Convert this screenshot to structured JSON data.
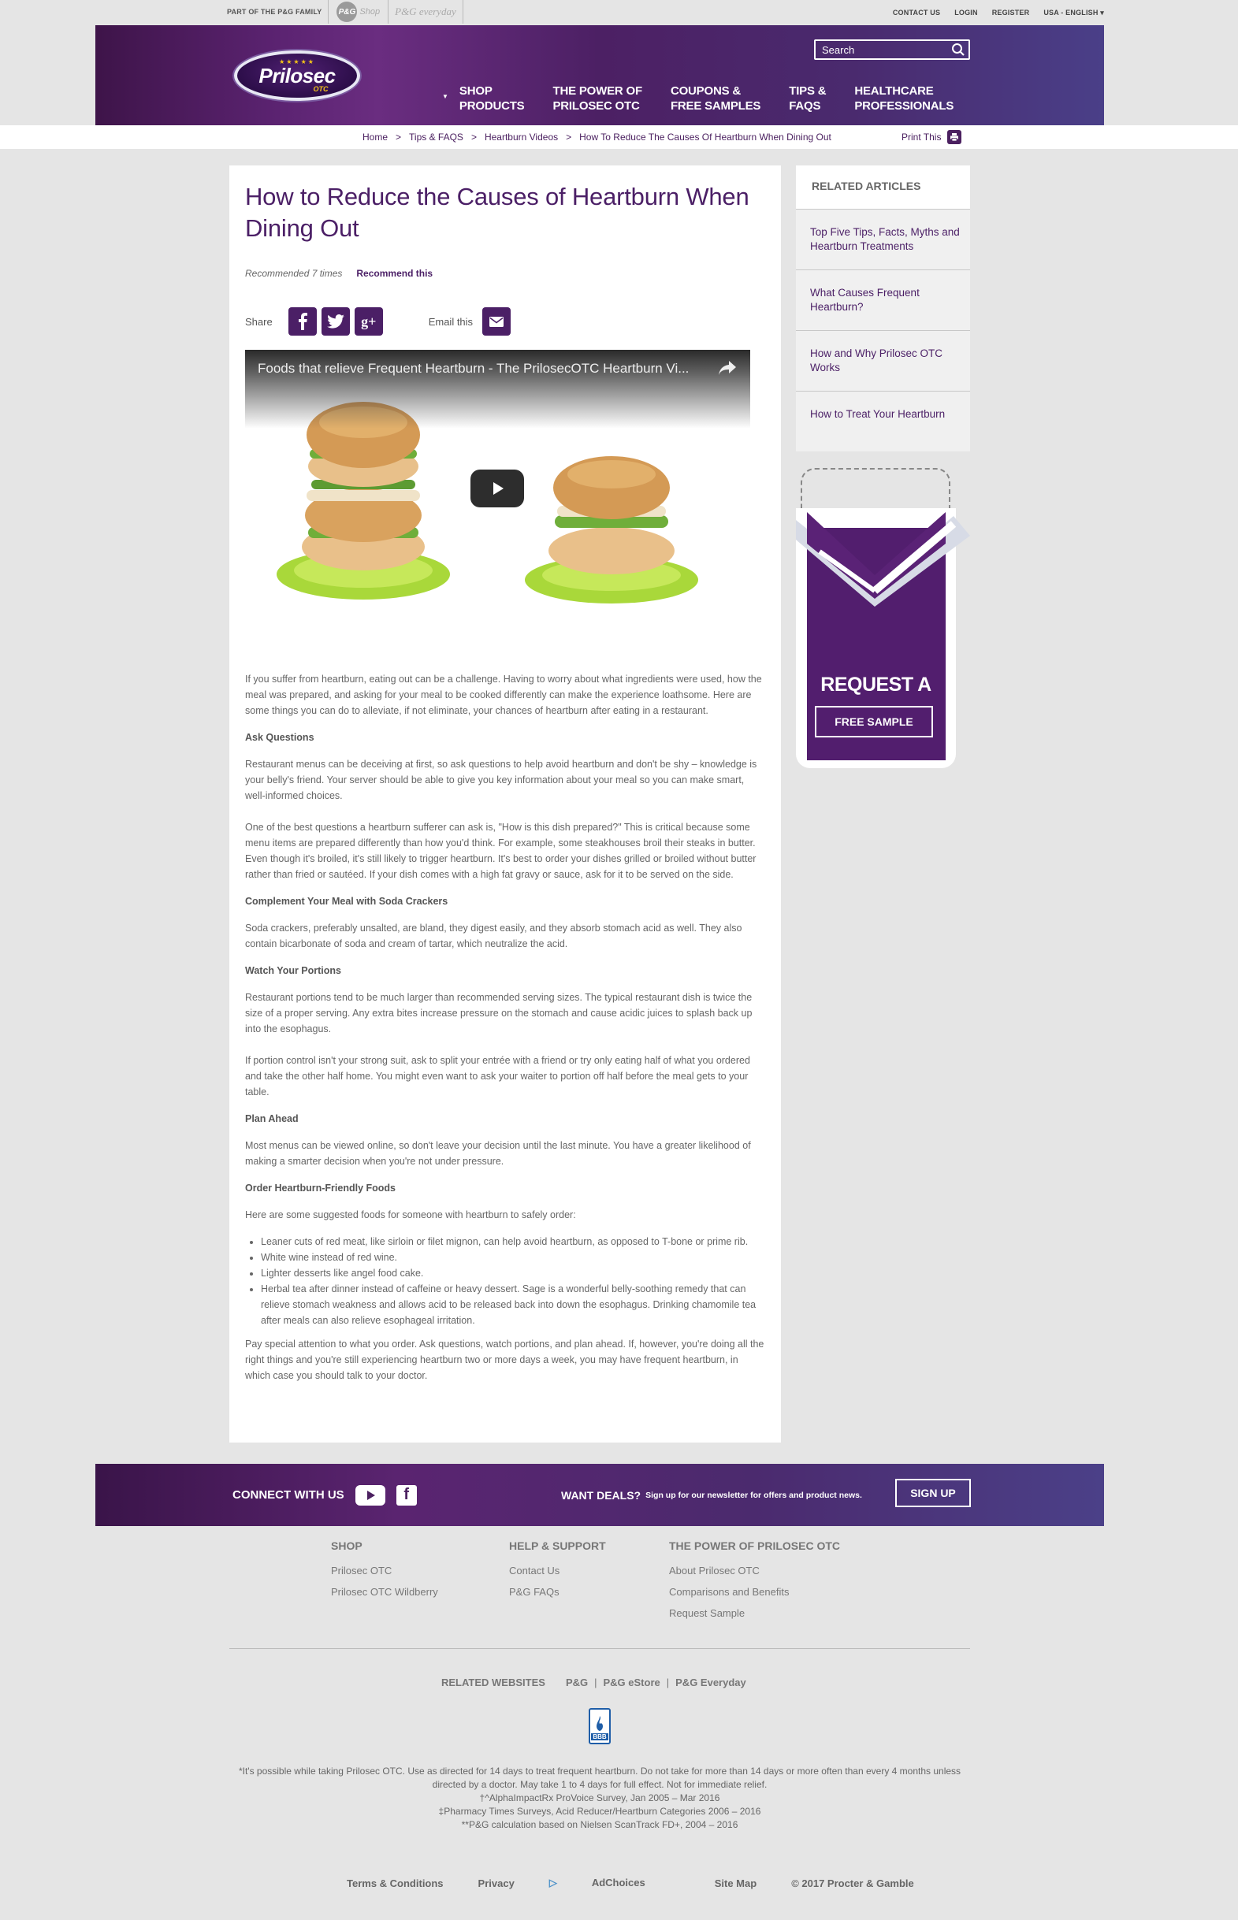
{
  "utility": {
    "pg_family": "PART OF THE P&G FAMILY",
    "pg_logo": "P&G",
    "pg_shop": "Shop",
    "pg_everyday": "P&G everyday",
    "links": [
      "CONTACT US",
      "LOGIN",
      "REGISTER",
      "USA - ENGLISH ▾"
    ]
  },
  "header": {
    "logo_name": "Prilosec",
    "logo_sub": "OTC",
    "logo_stars": "★★★★★",
    "search_placeholder": "Search",
    "nav": [
      "SHOP\nPRODUCTS",
      "THE POWER OF\nPRILOSEC OTC",
      "COUPONS &\nFREE SAMPLES",
      "TIPS &\nFAQS",
      "HEALTHCARE\nPROFESSIONALS"
    ],
    "brand_color": "#4b1f66"
  },
  "breadcrumb": {
    "items": [
      "Home",
      "Tips & FAQS",
      "Heartburn Videos",
      "How To Reduce The Causes Of Heartburn When Dining Out"
    ],
    "print_label": "Print This"
  },
  "article": {
    "title": "How to Reduce the Causes of Heartburn When Dining Out",
    "recommended": "Recommended 7 times",
    "recommend_link": "Recommend this",
    "share_label": "Share",
    "email_label": "Email this",
    "video_title": "Foods that relieve Frequent Heartburn - The PrilosecOTC Heartburn Vi...",
    "intro": "If you suffer from heartburn, eating out can be a challenge. Having to worry about what ingredients were used, how the meal was prepared, and asking for your meal to be cooked differently can make the experience loathsome. Here are some things you can do to alleviate, if not eliminate, your chances of heartburn after eating in a restaurant.",
    "h_ask": "Ask Questions",
    "p_ask1": "Restaurant menus can be deceiving at first, so ask questions to help avoid heartburn and don't be shy – knowledge is your belly's friend. Your server should be able to give you key information about your meal so you can make smart, well-informed choices.",
    "p_ask2": "One of the best questions a heartburn sufferer can ask is, \"How is this dish prepared?\" This is critical because some menu items are prepared differently than how you'd think. For example, some steakhouses broil their steaks in butter. Even though it's broiled, it's still likely to trigger heartburn. It's best to order your dishes grilled or broiled without butter rather than fried or sautéed. If your dish comes with a high fat gravy or sauce, ask for it to be served on the side.",
    "h_soda": "Complement Your Meal with Soda Crackers",
    "p_soda": "Soda crackers, preferably unsalted, are bland, they digest easily, and they absorb stomach acid as well. They also contain bicarbonate of soda and cream of tartar, which neutralize the acid.",
    "h_portions": "Watch Your Portions",
    "p_portions1": "Restaurant portions tend to be much larger than recommended serving sizes. The typical restaurant dish is twice the size of a proper serving. Any extra bites increase pressure on the stomach and cause acidic juices to splash back up into the esophagus.",
    "p_portions2": "If portion control isn't your strong suit, ask to split your entrée with a friend or try only eating half of what you ordered and take the other half home. You might even want to ask your waiter to portion off half before the meal gets to your table.",
    "h_plan": "Plan Ahead",
    "p_plan": "Most menus can be viewed online, so don't leave your decision until the last minute. You have a greater likelihood of making a smarter decision when you're not under pressure.",
    "h_order": "Order Heartburn-Friendly Foods",
    "p_order": "Here are some suggested foods for someone with heartburn to safely order:",
    "list": [
      "Leaner cuts of red meat, like sirloin or filet mignon, can help avoid heartburn, as opposed to T-bone or prime rib.",
      "White wine instead of red wine.",
      "Lighter desserts like angel food cake.",
      "Herbal tea after dinner instead of caffeine or heavy dessert. Sage is a wonderful belly-soothing remedy that can relieve stomach weakness and allows acid to be released back into down the esophagus. Drinking chamomile tea after meals can also relieve esophageal irritation."
    ],
    "p_final": "Pay special attention to what you order. Ask questions, watch portions, and plan ahead. If, however, you're doing all the right things and you're still experiencing heartburn two or more days a week, you may have frequent heartburn, in which case you should talk to your doctor."
  },
  "sidebar": {
    "related_title": "RELATED ARTICLES",
    "related": [
      "Top Five Tips, Facts, Myths and Heartburn Treatments",
      "What Causes Frequent Heartburn?",
      "How and Why Prilosec OTC Works",
      "How to Treat Your Heartburn"
    ],
    "sample_title": "REQUEST A",
    "sample_button": "FREE SAMPLE"
  },
  "footer": {
    "connect": "CONNECT WITH US",
    "want_deals": "WANT DEALS?",
    "deals_text": "Sign up for our newsletter for offers and product news.",
    "signup": "SIGN UP",
    "cols": [
      {
        "title": "SHOP",
        "links": [
          "Prilosec OTC",
          "Prilosec OTC Wildberry"
        ]
      },
      {
        "title": "HELP & SUPPORT",
        "links": [
          "Contact Us",
          "P&G FAQs"
        ]
      },
      {
        "title": "THE POWER OF PRILOSEC OTC",
        "links": [
          "About Prilosec OTC",
          "Comparisons and Benefits",
          "Request Sample"
        ]
      }
    ],
    "related_websites": "RELATED WEBSITES",
    "sites": [
      "P&G",
      "P&G eStore",
      "P&G Everyday"
    ],
    "bbb": "BBB",
    "disclaimer": [
      "*It's possible while taking Prilosec OTC. Use as directed for 14 days to treat frequent heartburn. Do not take for more than 14 days or more often than every 4 months unless directed by a doctor. May take 1 to 4 days for full effect. Not for immediate relief.",
      "†^AlphaImpactRx ProVoice Survey, Jan 2005 – Mar 2016",
      "‡Pharmacy Times Surveys, Acid Reducer/Heartburn Categories 2006 – 2016",
      "**P&G calculation based on Nielsen ScanTrack FD+, 2004 – 2016"
    ],
    "legal": [
      "Terms & Conditions",
      "Privacy",
      "AdChoices",
      "Site Map",
      "© 2017 Procter & Gamble"
    ]
  }
}
